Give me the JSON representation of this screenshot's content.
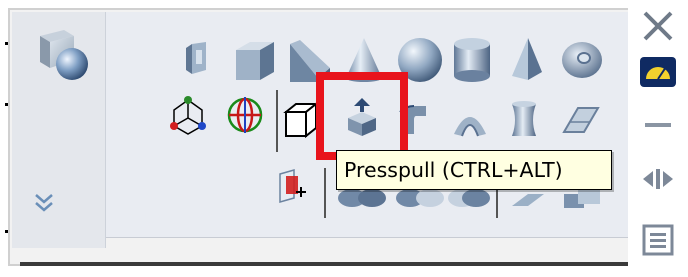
{
  "tooltip": {
    "text": "Presspull (CTRL+ALT)"
  },
  "highlight_color": "#e8141c",
  "panel": {
    "left_icon": "solid-modeling-icon",
    "expand_icon": "chevron-double-down-icon"
  },
  "row1_icons": [
    "box-face-icon",
    "box-icon",
    "wedge-icon",
    "cone-icon",
    "sphere-icon",
    "cylinder-icon",
    "pyramid-icon",
    "torus-icon"
  ],
  "row2_icons": [
    "ucs-icon",
    "view-globe-icon",
    "extrude-icon",
    "presspull-icon",
    "revolve-icon",
    "sweep-icon",
    "loft-icon",
    "planar-surface-icon"
  ],
  "row3_icons": [
    "section-plane-icon",
    "union-icon",
    "subtract-icon",
    "intersect-icon",
    "slice-icon",
    "interfere-icon"
  ],
  "right_strip": [
    "close-icon",
    "properties-meter-icon",
    "minimize-icon",
    "dock-arrows-icon",
    "list-icon"
  ]
}
